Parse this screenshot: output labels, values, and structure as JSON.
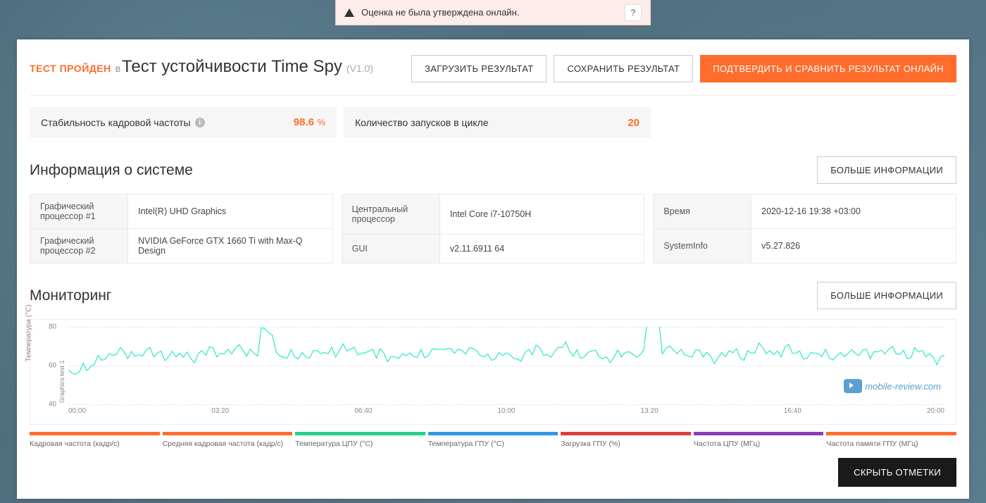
{
  "alert": {
    "text": "Оценка не была утверждена онлайн.",
    "help": "?"
  },
  "header": {
    "passed_label": "ТЕСТ ПРОЙДЕН",
    "in_word": "В",
    "test_name": "Тест устойчивости Time Spy",
    "version": "(V1.0)",
    "buttons": {
      "load": "ЗАГРУЗИТЬ РЕЗУЛЬТАТ",
      "save": "СОХРАНИТЬ РЕЗУЛЬТАТ",
      "compare": "ПОДТВЕРДИТЬ И СРАВНИТЬ РЕЗУЛЬТАТ ОНЛАЙН"
    }
  },
  "stats": {
    "stability_label": "Стабильность кадровой частоты",
    "stability_value": "98.6",
    "stability_unit": "%",
    "loops_label": "Количество запусков в цикле",
    "loops_value": "20"
  },
  "sysinfo": {
    "title": "Информация о системе",
    "more_button": "БОЛЬШЕ ИНФОРМАЦИИ",
    "gpu1_k": "Графический процессор #1",
    "gpu1_v": "Intel(R) UHD Graphics",
    "gpu2_k": "Графический процессор #2",
    "gpu2_v": "NVIDIA GeForce GTX 1660 Ti with Max-Q Design",
    "cpu_k": "Центральный процессор",
    "cpu_v": "Intel Core i7-10750H",
    "gui_k": "GUI",
    "gui_v": "v2.11.6911 64",
    "time_k": "Время",
    "time_v": "2020-12-16 19:38 +03:00",
    "si_k": "SystemInfo",
    "si_v": "v5.27.826"
  },
  "monitoring": {
    "title": "Мониторинг",
    "more_button": "БОЛЬШЕ ИНФОРМАЦИИ",
    "y_label": "Температура (°C)",
    "run_label": "Graphics test 1",
    "hide_button": "СКРЫТЬ ОТМЕТКИ"
  },
  "chart_data": {
    "type": "line",
    "title": "",
    "xlabel": "",
    "ylabel": "Температура (°C)",
    "ylim": [
      40,
      80
    ],
    "y_ticks": [
      40,
      60,
      80
    ],
    "x_ticks": [
      "00:00",
      "03:20",
      "06:40",
      "10:00",
      "13:20",
      "16:40",
      "20:00"
    ],
    "series": [
      {
        "name": "Температура ГПУ (°C)",
        "color": "#2ee8c4",
        "approx_values_over_time": [
          58,
          60,
          64,
          65,
          65,
          66,
          67,
          66,
          66,
          67,
          66,
          67,
          66,
          78,
          66,
          67,
          66,
          67,
          66,
          67,
          66,
          67,
          66,
          67,
          66,
          67,
          66,
          67,
          66,
          67,
          66,
          67,
          65,
          67,
          66,
          67,
          66,
          67,
          66,
          82,
          67,
          66,
          67,
          66,
          67,
          66,
          67,
          66,
          67,
          66,
          67,
          66,
          67,
          66,
          66,
          66,
          66,
          67,
          66,
          65
        ]
      }
    ]
  },
  "legend": [
    {
      "label": "Кадровая частота (кадр/с)",
      "color": "#FF6C2C"
    },
    {
      "label": "Средняя кадровая частота (кадр/с)",
      "color": "#FF6C2C"
    },
    {
      "label": "Температура ЦПУ (°C)",
      "color": "#23d18b"
    },
    {
      "label": "Температура ГПУ (°C)",
      "color": "#2f9ae8"
    },
    {
      "label": "Загрузка ГПУ (%)",
      "color": "#e03c3c"
    },
    {
      "label": "Частота ЦПУ (МГц)",
      "color": "#8a3cc0"
    },
    {
      "label": "Частота памяти ГПУ (МГц)",
      "color": "#FF6C2C"
    }
  ],
  "watermark": "mobile-review.com"
}
